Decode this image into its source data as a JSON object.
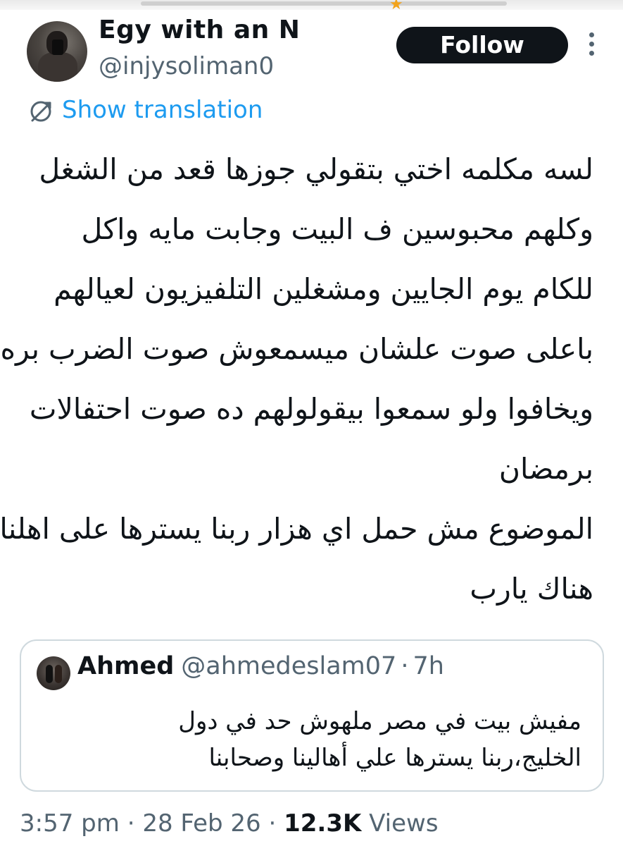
{
  "post": {
    "author": {
      "display_name": "Egy with an N",
      "handle": "@injysoliman0"
    },
    "follow_label": "Follow",
    "translation_label": "Show translation",
    "text_lines": [
      "لسه مكلمه اختي بتقولي جوزها قعد من الشغل",
      "وكلهم محبوسين ف البيت وجابت مايه واكل",
      "للكام يوم الجايين ومشغلين التلفيزيون لعيالهم",
      "باعلى صوت علشان ميسمعوش صوت الضرب بره",
      "ويخافوا ولو سمعوا بيقولولهم ده صوت احتفالات",
      "برمضان",
      "الموضوع مش حمل اي هزار ربنا يسترها على اهلنا",
      "هناك يارب"
    ],
    "quoted": {
      "display_name": "Ahmed",
      "handle": "@ahmedeslam07",
      "separator": "·",
      "time": "7h",
      "text_lines": [
        "مفيش بيت في مصر ملهوش حد في دول",
        "الخليج،ربنا يسترها علي أهالينا وصحابنا"
      ]
    },
    "meta": {
      "time": "3:57 pm",
      "date": "28 Feb 26",
      "separator": "·",
      "views_count": "12.3K",
      "views_label": "Views"
    }
  },
  "icons": {
    "more": "more-dots-vertical-icon",
    "translate": "translate-globe-icon"
  },
  "colors": {
    "link": "#1d9bf0",
    "muted": "#536471",
    "text": "#0f1419",
    "button_bg": "#0f1419"
  }
}
